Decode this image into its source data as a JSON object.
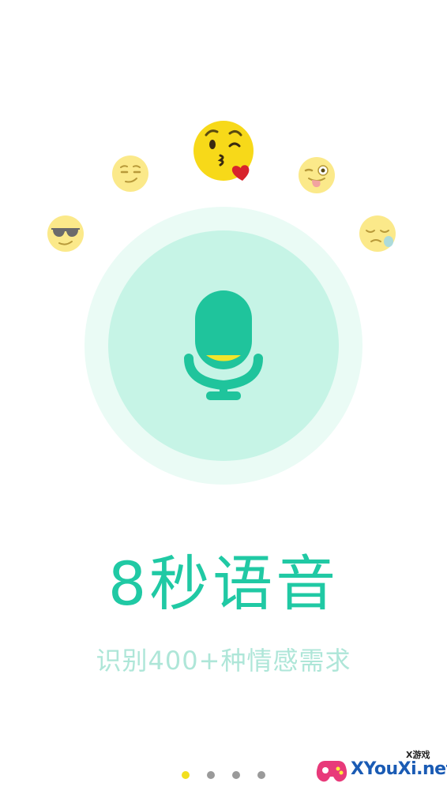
{
  "hero": {
    "title": "8秒语音",
    "subtitle": "识别400+种情感需求"
  },
  "emojis": [
    {
      "name": "sunglasses-emoji-icon"
    },
    {
      "name": "smirk-emoji-icon"
    },
    {
      "name": "kiss-emoji-icon"
    },
    {
      "name": "wink-tongue-emoji-icon"
    },
    {
      "name": "sleepy-emoji-icon"
    }
  ],
  "pager": {
    "pages": 4,
    "active": 1
  },
  "watermark": {
    "small": "X游戏",
    "main": "XYouXi.net"
  },
  "colors": {
    "accent": "#20c9a4",
    "subtitle": "#aee6d8",
    "circle_outer": "#eafbf5",
    "circle_inner": "#c6f4e6",
    "mic": "#1fc49c",
    "mic_level": "#f2e52a",
    "emoji_face": "#fbe98a",
    "dot_active": "#f2df1e",
    "dot_inactive": "#9a9a9a"
  }
}
